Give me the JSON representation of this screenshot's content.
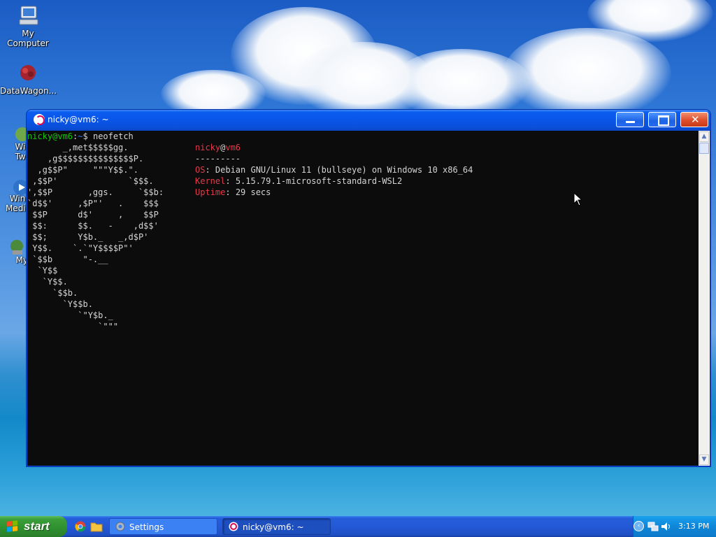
{
  "desktop": {
    "icons": [
      {
        "name": "my-computer",
        "label": "My Computer"
      },
      {
        "name": "datawagon",
        "label": "DataWagon..."
      },
      {
        "name": "twe",
        "label_line1": "Win",
        "label_line2": "Twe"
      },
      {
        "name": "media",
        "label_line1": "Wind",
        "label_line2": "Media"
      },
      {
        "name": "my",
        "label": "My"
      }
    ]
  },
  "window": {
    "title": "nicky@vm6: ~",
    "buttons": {
      "minimize": "minimize",
      "maximize": "maximize",
      "close": "close"
    }
  },
  "terminal": {
    "prompt_user": "nicky@vm6",
    "prompt_sep": ":",
    "prompt_path": "~",
    "prompt_symbol": "$",
    "command": "neofetch",
    "info": {
      "user": "nicky",
      "at": "@",
      "host": "vm6",
      "separator": "---------",
      "os_label": "OS",
      "os_value": "Debian GNU/Linux 11 (bullseye) on Windows 10 x86_64",
      "kernel_label": "Kernel",
      "kernel_value": "5.15.79.1-microsoft-standard-WSL2",
      "uptime_label": "Uptime",
      "uptime_value": "29 secs"
    },
    "ascii_art": [
      "       _,met$$$$$gg.",
      "    ,g$$$$$$$$$$$$$$$P.",
      "  ,g$$P\"     \"\"\"Y$$.\".",
      " ,$$P'              `$$$.",
      "',$$P       ,ggs.     `$$b:",
      "`d$$'     ,$P\"'   .    $$$",
      " $$P      d$'     ,    $$P",
      " $$:      $$.   -    ,d$$'",
      " $$;      Y$b._   _,d$P'",
      " Y$$.    `.`\"Y$$$$P\"'",
      " `$$b      \"-.__",
      "  `Y$$",
      "   `Y$$.",
      "     `$$b.",
      "       `Y$$b.",
      "          `\"Y$b._",
      "              `\"\"\""
    ]
  },
  "taskbar": {
    "start_label": "start",
    "quick_launch": [
      "chrome-icon",
      "folder-icon"
    ],
    "tasks": [
      {
        "label": "Settings",
        "active": false
      },
      {
        "label": "nicky@vm6: ~",
        "active": true
      }
    ],
    "clock": "3:13 PM"
  },
  "colors": {
    "prompt_green": "#16c60c",
    "path_blue": "#3b78ff",
    "debian_red": "#e03b4a",
    "terminal_bg": "#0c0c0c",
    "xp_blue": "#0a55e8"
  }
}
